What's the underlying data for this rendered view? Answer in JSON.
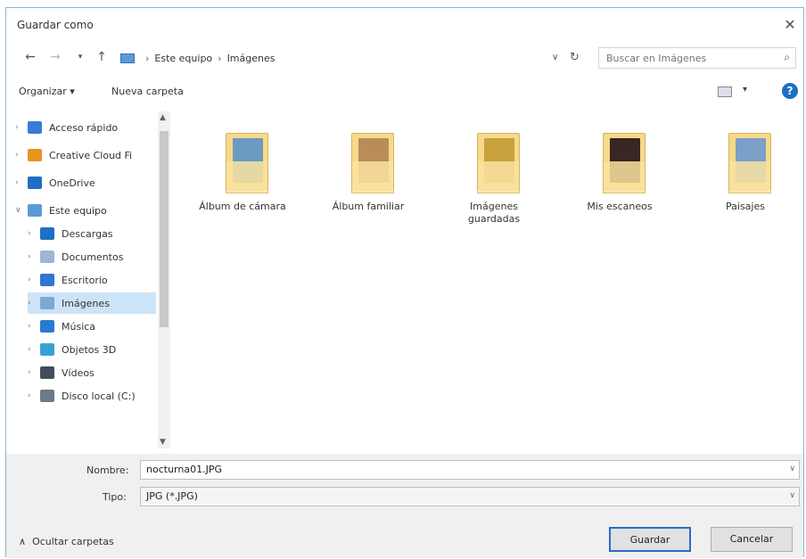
{
  "window": {
    "title": "Guardar como"
  },
  "nav": {
    "path": [
      "Este equipo",
      "Imágenes"
    ],
    "search_placeholder": "Buscar en Imágenes"
  },
  "toolbar": {
    "organize_label": "Organizar ▾",
    "new_folder_label": "Nueva carpeta"
  },
  "sidebar": {
    "items": [
      {
        "label": "Acceso rápido",
        "icon": "star-icon",
        "color": "#3a7bd5"
      },
      {
        "label": "Creative Cloud Fi",
        "icon": "creative-cloud-icon",
        "color": "#e8941a"
      },
      {
        "label": "OneDrive",
        "icon": "cloud-icon",
        "color": "#1e6fc4"
      },
      {
        "label": "Este equipo",
        "icon": "computer-icon",
        "color": "#5b9bd5"
      },
      {
        "label": "Descargas",
        "icon": "download-icon",
        "color": "#1e6fc4"
      },
      {
        "label": "Documentos",
        "icon": "documents-icon",
        "color": "#9bb6d6"
      },
      {
        "label": "Escritorio",
        "icon": "desktop-icon",
        "color": "#2e75d6"
      },
      {
        "label": "Imágenes",
        "icon": "pictures-icon",
        "color": "#7fa7d6"
      },
      {
        "label": "Música",
        "icon": "music-icon",
        "color": "#2a7ad0"
      },
      {
        "label": "Objetos 3D",
        "icon": "cube-icon",
        "color": "#3aa0d8"
      },
      {
        "label": "Vídeos",
        "icon": "video-icon",
        "color": "#444c5c"
      },
      {
        "label": "Disco local (C:)",
        "icon": "disk-icon",
        "color": "#6c7a89"
      }
    ]
  },
  "folders": [
    {
      "label": "Álbum de cámara",
      "photo_color": "#6c9bc2"
    },
    {
      "label": "Álbum familiar",
      "photo_color": "#b88d5a"
    },
    {
      "label": "Imágenes guardadas",
      "photo_color": "#c8a03c"
    },
    {
      "label": "Mis escaneos",
      "photo_color": "#3a2622"
    },
    {
      "label": "Paisajes",
      "photo_color": "#7aa0c8"
    }
  ],
  "form": {
    "name_label": "Nombre:",
    "name_value": "nocturna01.JPG",
    "type_label": "Tipo:",
    "type_value": "JPG (*.JPG)"
  },
  "footer": {
    "hide_folders_label": "Ocultar carpetas",
    "save_label": "Guardar",
    "cancel_label": "Cancelar"
  }
}
